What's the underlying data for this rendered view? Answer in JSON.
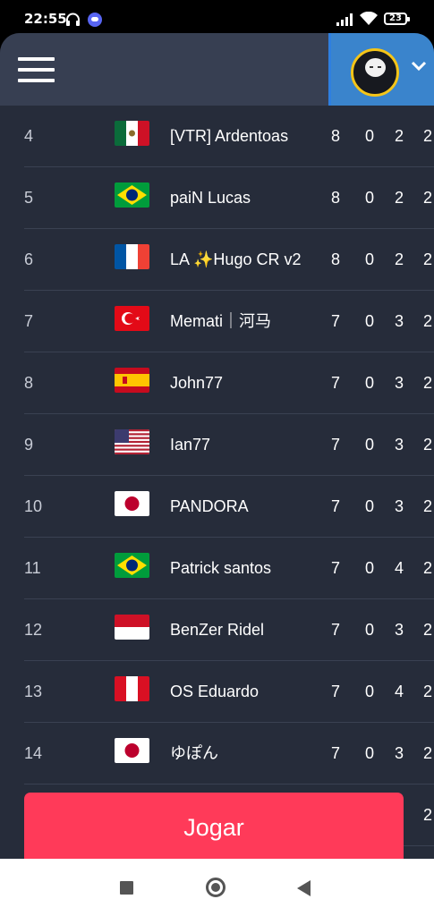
{
  "status_bar": {
    "time": "22:55",
    "battery": "23",
    "icons": [
      "headset-icon",
      "discord-icon",
      "signal-icon",
      "wifi-icon",
      "battery-icon"
    ]
  },
  "header": {
    "menu_icon": "hamburger-menu-icon",
    "profile_icon": "avatar",
    "dropdown_icon": "chevron-down-icon"
  },
  "leaderboard": [
    {
      "rank": "4",
      "flag": "mexico",
      "name": "[VTR] Ardentoas",
      "s1": "8",
      "s2": "0",
      "s3": "2",
      "s4": "2"
    },
    {
      "rank": "5",
      "flag": "brazil",
      "name": "paiN Lucas",
      "s1": "8",
      "s2": "0",
      "s3": "2",
      "s4": "2"
    },
    {
      "rank": "6",
      "flag": "france",
      "name": "LA ✨Hugo CR v2",
      "s1": "8",
      "s2": "0",
      "s3": "2",
      "s4": "2"
    },
    {
      "rank": "7",
      "flag": "turkey",
      "name": "Memati｜河马",
      "s1": "7",
      "s2": "0",
      "s3": "3",
      "s4": "2"
    },
    {
      "rank": "8",
      "flag": "spain",
      "name": "John77",
      "s1": "7",
      "s2": "0",
      "s3": "3",
      "s4": "2"
    },
    {
      "rank": "9",
      "flag": "usa",
      "name": "Ian77",
      "s1": "7",
      "s2": "0",
      "s3": "3",
      "s4": "2"
    },
    {
      "rank": "10",
      "flag": "japan",
      "name": "PANDORA",
      "s1": "7",
      "s2": "0",
      "s3": "3",
      "s4": "2"
    },
    {
      "rank": "11",
      "flag": "brazil",
      "name": "Patrick santos",
      "s1": "7",
      "s2": "0",
      "s3": "4",
      "s4": "2"
    },
    {
      "rank": "12",
      "flag": "indonesia",
      "name": "BenZer Ridel",
      "s1": "7",
      "s2": "0",
      "s3": "3",
      "s4": "2"
    },
    {
      "rank": "13",
      "flag": "peru",
      "name": "OS Eduardo",
      "s1": "7",
      "s2": "0",
      "s3": "4",
      "s4": "2"
    },
    {
      "rank": "14",
      "flag": "japan",
      "name": "ゆぽん",
      "s1": "7",
      "s2": "0",
      "s3": "3",
      "s4": "2"
    }
  ],
  "partial_row": {
    "s4": "2"
  },
  "play_button": {
    "label": "Jogar"
  },
  "colors": {
    "play": "#ff3a59",
    "background": "#262c3a",
    "header": "#373f52",
    "profile_bg": "#3a84cc"
  },
  "navbar": {
    "icons": [
      "recents-icon",
      "home-icon",
      "back-icon"
    ]
  }
}
